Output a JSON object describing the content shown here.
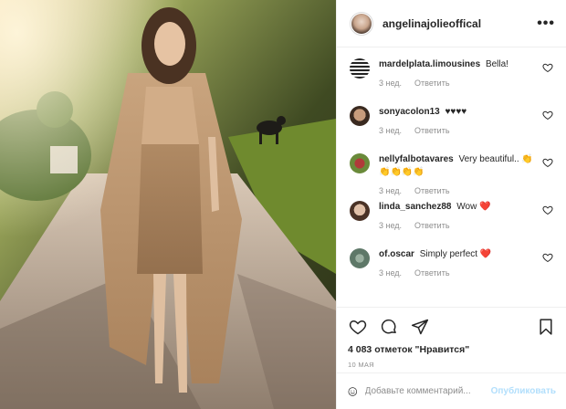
{
  "post": {
    "username": "angelinajolieoffical",
    "more_icon": "more-horizontal-icon"
  },
  "comments": [
    {
      "user": "mardelplata.limousines",
      "text": "Bella!",
      "time": "3 нед.",
      "reply": "Ответить"
    },
    {
      "user": "sonyacolon13",
      "text": "♥♥♥♥",
      "time": "3 нед.",
      "reply": "Ответить"
    },
    {
      "user": "nellyfalbotavares",
      "text": "Very beautiful.. 👏👏👏👏👏",
      "time": "3 нед.",
      "reply": "Ответить"
    },
    {
      "user": "linda_sanchez88",
      "text": "Wow ❤️",
      "time": "3 нед.",
      "reply": "Ответить"
    },
    {
      "user": "of.oscar",
      "text": "Simply perfect ❤️",
      "time": "3 нед.",
      "reply": "Ответить"
    }
  ],
  "actions": {
    "likes": "4 083 отметок \"Нравится\"",
    "date": "10 мая",
    "icons": [
      "heart-icon",
      "comment-icon",
      "share-icon",
      "bookmark-icon"
    ]
  },
  "add_comment": {
    "placeholder": "Добавьте комментарий...",
    "post_label": "Опубликовать"
  },
  "colors": {
    "accent": "#0095f6",
    "accent_disabled": "#b2dffc",
    "like_red": "#ed4956",
    "muted": "#8e8e8e"
  }
}
